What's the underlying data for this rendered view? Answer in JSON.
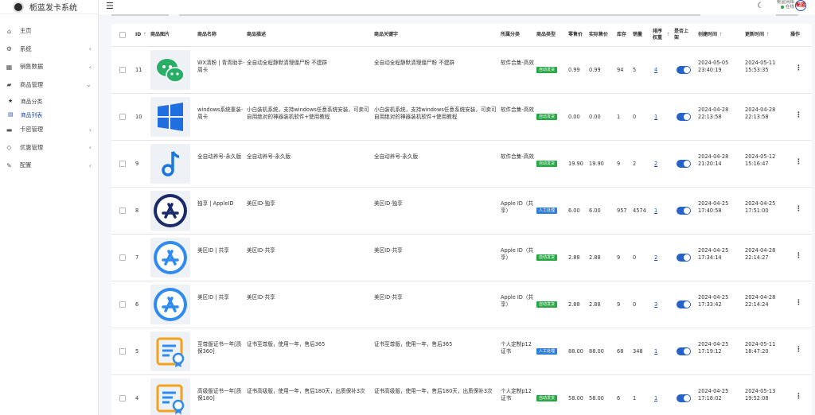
{
  "brand": {
    "name": "栀蓝发卡系统"
  },
  "header": {
    "user_name": "栀蓝网络",
    "status": "在线",
    "avatar_text": "栀蓝"
  },
  "sidebar": {
    "items": [
      {
        "icon": "home-icon",
        "label": "主页",
        "has_arrow": false
      },
      {
        "icon": "gear-icon",
        "label": "系统",
        "has_arrow": true
      },
      {
        "icon": "table-icon",
        "label": "销售数据",
        "has_arrow": true
      },
      {
        "icon": "bag-icon",
        "label": "商品管理",
        "has_arrow": true,
        "expanded": true,
        "children": [
          {
            "icon": "star-icon",
            "label": "商品分类"
          },
          {
            "icon": "list-icon",
            "label": "商品列表",
            "active": true
          }
        ]
      },
      {
        "icon": "card-icon",
        "label": "卡密管理",
        "has_arrow": true
      },
      {
        "icon": "gem-icon",
        "label": "优惠管理",
        "has_arrow": true
      },
      {
        "icon": "wrench-icon",
        "label": "配置",
        "has_arrow": true
      }
    ]
  },
  "table": {
    "columns": [
      "ID",
      "商品图片",
      "商品名称",
      "商品描述",
      "商品关键字",
      "所属分类",
      "商品类型",
      "零售价",
      "实际售价",
      "库存",
      "销量",
      "排序权重",
      "是否上架",
      "创建时间",
      "更新时间",
      "操作"
    ],
    "rows": [
      {
        "id": "11",
        "img": "wechat-icon",
        "name": "WX清粉 | 青青助手-周卡",
        "desc": "全自动全程静默清理僵尸粉 不建群",
        "keywords": "全自动全程静默清理僵尸粉 不建群",
        "category": "软件合集-高效",
        "type": "自动发货",
        "type_color": "#28a745",
        "price": "0.99",
        "actual": "0.99",
        "stock": "94",
        "sales": "5",
        "sort": "4",
        "created": "2024-05-05 23:40:19",
        "updated": "2024-05-11 15:53:35"
      },
      {
        "id": "10",
        "img": "windows-icon",
        "name": "windows系统重装-周卡",
        "desc": "小白装机系统，支持windows任意系统安装，可卖可自用绝对的神器装机软件+使用教程",
        "keywords": "小白装机系统，支持windows任意系统安装，可卖可自用绝对的神器装机软件+使用教程",
        "category": "软件合集-高效",
        "type": "自动发货",
        "type_color": "#28a745",
        "price": "0.00",
        "actual": "0.00",
        "stock": "1",
        "sales": "0",
        "sort": "1",
        "created": "2024-04-28 22:13:58",
        "updated": "2024-04-28 22:13:58"
      },
      {
        "id": "9",
        "img": "music-note-icon",
        "name": "全自动养号-永久版",
        "desc": "全自动养号-永久版",
        "keywords": "全自动养号-永久版",
        "category": "软件合集-高效",
        "type": "自动发货",
        "type_color": "#28a745",
        "price": "19.90",
        "actual": "19.90",
        "stock": "9",
        "sales": "2",
        "sort": "2",
        "created": "2024-04-28 21:20:14",
        "updated": "2024-05-12 15:16:47"
      },
      {
        "id": "8",
        "img": "appstore-dark-icon",
        "name": "独享 | AppleID",
        "desc": "美区ID-独享",
        "keywords": "美区ID-独享",
        "category": "Apple ID（共享）",
        "type": "人工处理",
        "type_color": "#2f7fd8",
        "price": "6.00",
        "actual": "6.00",
        "stock": "957",
        "sales": "4574",
        "sort": "1",
        "created": "2024-04-25 17:40:58",
        "updated": "2024-04-25 17:51:00"
      },
      {
        "id": "7",
        "img": "appstore-blue-icon",
        "name": "美区ID | 共享",
        "desc": "美区ID-共享",
        "keywords": "美区ID-共享",
        "category": "Apple ID（共享）",
        "type": "自动发货",
        "type_color": "#28a745",
        "price": "2.88",
        "actual": "2.88",
        "stock": "9",
        "sales": "0",
        "sort": "2",
        "created": "2024-04-25 17:34:14",
        "updated": "2024-04-28 22:14:27"
      },
      {
        "id": "6",
        "img": "appstore-blue-icon",
        "name": "美区ID | 共享",
        "desc": "美区ID-共享",
        "keywords": "美区ID-共享",
        "category": "Apple ID（共享）",
        "type": "自动发货",
        "type_color": "#28a745",
        "price": "2.88",
        "actual": "2.88",
        "stock": "9",
        "sales": "0",
        "sort": "3",
        "created": "2024-04-25 17:33:42",
        "updated": "2024-04-28 22:14:24"
      },
      {
        "id": "5",
        "img": "certificate-icon",
        "name": "至尊版证书一年[质保360]",
        "desc": "证书至尊版，使用一年，售后365",
        "keywords": "证书至尊版，使用一年，售后365",
        "category": "个人定制p12证书",
        "type": "人工处理",
        "type_color": "#2f7fd8",
        "price": "88.00",
        "actual": "88.00",
        "stock": "68",
        "sales": "348",
        "sort": "1",
        "created": "2024-04-25 17:19:12",
        "updated": "2024-05-11 18:47:20"
      },
      {
        "id": "4",
        "img": "certificate-icon",
        "name": "高级版证书一年[质保180]",
        "desc": "证书高级版，使用一年，售后180天，出质保补3次",
        "keywords": "证书高级版，使用一年，售后180天，出质保补3次",
        "category": "个人定制p12证书",
        "type": "自动发货",
        "type_color": "#28a745",
        "price": "58.00",
        "actual": "58.00",
        "stock": "6",
        "sales": "1",
        "sort": "1",
        "created": "2024-04-25 17:18:02",
        "updated": "2024-05-13 19:52:08"
      }
    ]
  }
}
